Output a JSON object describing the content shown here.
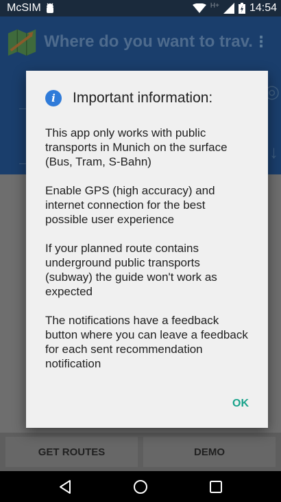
{
  "status_bar": {
    "carrier": "McSIM",
    "network_type": "H+",
    "time": "14:54",
    "icons": [
      "android-debug-icon",
      "wifi-icon",
      "signal-icon",
      "battery-icon"
    ]
  },
  "app_bar": {
    "title": "Where do you want to trav...",
    "menu_icon": "overflow-menu-icon",
    "logo_icon": "map-logo-icon"
  },
  "bottom_buttons": {
    "get_routes": "GET ROUTES",
    "demo": "DEMO"
  },
  "dialog": {
    "title": "Important information:",
    "icon": "info-icon",
    "paragraphs": [
      "This app only works with public transports in Munich on the surface (Bus, Tram, S-Bahn)",
      "Enable GPS (high accuracy) and internet connection for the best possible user experience",
      "If your planned route contains underground public transports (subway) the guide won't work as expected",
      "The notifications have a feedback button where you can leave a feedback for each sent recommendation notification"
    ],
    "ok_label": "OK"
  },
  "nav_bar": {
    "icons": [
      "back-icon",
      "home-icon",
      "recents-icon"
    ]
  },
  "colors": {
    "accent": "#19a38b",
    "info_blue": "#2f7bd9",
    "app_bar": "#1a3e6c"
  }
}
